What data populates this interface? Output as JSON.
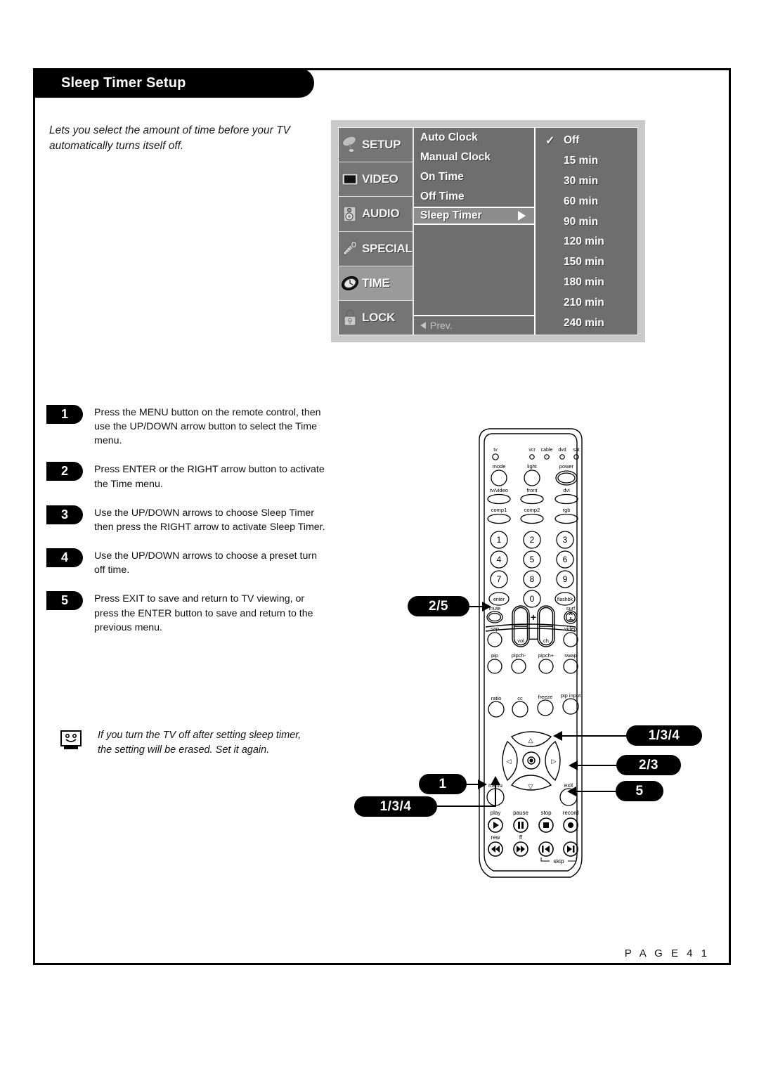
{
  "header": {
    "title": "Sleep Timer Setup"
  },
  "intro": "Lets you select the amount of time before your TV automatically turns itself off.",
  "osd": {
    "categories": [
      {
        "label": "SETUP",
        "icon": "satellite-dish-icon",
        "active": false
      },
      {
        "label": "VIDEO",
        "icon": "tv-screen-icon",
        "active": false
      },
      {
        "label": "AUDIO",
        "icon": "speaker-icon",
        "active": false
      },
      {
        "label": "SPECIAL",
        "icon": "tag-icon",
        "active": false
      },
      {
        "label": "TIME",
        "icon": "clock-icon",
        "active": true
      },
      {
        "label": "LOCK",
        "icon": "padlock-icon",
        "active": false
      }
    ],
    "items": [
      {
        "label": "Auto Clock",
        "selected": false
      },
      {
        "label": "Manual Clock",
        "selected": false
      },
      {
        "label": "On Time",
        "selected": false
      },
      {
        "label": "Off Time",
        "selected": false
      },
      {
        "label": "Sleep Timer",
        "selected": true
      }
    ],
    "prev_label": "Prev.",
    "options": [
      {
        "label": "Off",
        "checked": true
      },
      {
        "label": "15 min",
        "checked": false
      },
      {
        "label": "30 min",
        "checked": false
      },
      {
        "label": "60 min",
        "checked": false
      },
      {
        "label": "90 min",
        "checked": false
      },
      {
        "label": "120 min",
        "checked": false
      },
      {
        "label": "150 min",
        "checked": false
      },
      {
        "label": "180 min",
        "checked": false
      },
      {
        "label": "210 min",
        "checked": false
      },
      {
        "label": "240 min",
        "checked": false
      }
    ],
    "checkmark": "✓"
  },
  "steps": [
    {
      "num": "1",
      "text": "Press the MENU button on the remote control, then use the UP/DOWN arrow button to select the Time menu."
    },
    {
      "num": "2",
      "text": "Press ENTER or the RIGHT arrow button to activate the Time menu."
    },
    {
      "num": "3",
      "text": "Use the UP/DOWN arrows to choose Sleep Timer then press the RIGHT arrow to activate Sleep Timer."
    },
    {
      "num": "4",
      "text": "Use the UP/DOWN arrows to choose a preset turn off time."
    },
    {
      "num": "5",
      "text": "Press EXIT to save and return to TV viewing, or press the ENTER button to save and return to the previous menu."
    }
  ],
  "note": {
    "icon": "tv-smiley-icon",
    "text": "If you turn the TV off after setting sleep timer, the setting will be erased. Set it again."
  },
  "page_number": "P A G E  4 1",
  "remote": {
    "leds": [
      "tv",
      "vcr",
      "cable",
      "dvd",
      "sat"
    ],
    "row_mode": [
      "mode",
      "light",
      "power"
    ],
    "row_input1": [
      "tv/video",
      "front",
      "dvi"
    ],
    "row_input2": [
      "comp1",
      "comp2",
      "rgb"
    ],
    "keypad": [
      "1",
      "2",
      "3",
      "4",
      "5",
      "6",
      "7",
      "8",
      "9",
      "enter",
      "0",
      "flashbk"
    ],
    "row_mute": [
      "mute",
      "surf"
    ],
    "row_sap": [
      "sap",
      "video"
    ],
    "rockers": {
      "vol": "vol",
      "ch": "ch",
      "plus": "+",
      "minus": "—"
    },
    "row_pip": [
      "pip",
      "pipch-",
      "pipch+",
      "swap"
    ],
    "row_ratio": [
      "ratio",
      "cc",
      "freeze",
      "pip input"
    ],
    "dpad": {
      "up": "△",
      "down": "▽",
      "left": "◁",
      "right": "▷",
      "center": "◉"
    },
    "menu": "menu",
    "exit": "exit",
    "row_play": [
      "play",
      "pause",
      "stop",
      "record"
    ],
    "row_rew": [
      "rew",
      "ff"
    ],
    "skip": "skip"
  },
  "callouts": {
    "enter": "2/5",
    "menu": "1",
    "down": "1/3/4",
    "up": "1/3/4",
    "right": "2/3",
    "exit": "5"
  }
}
